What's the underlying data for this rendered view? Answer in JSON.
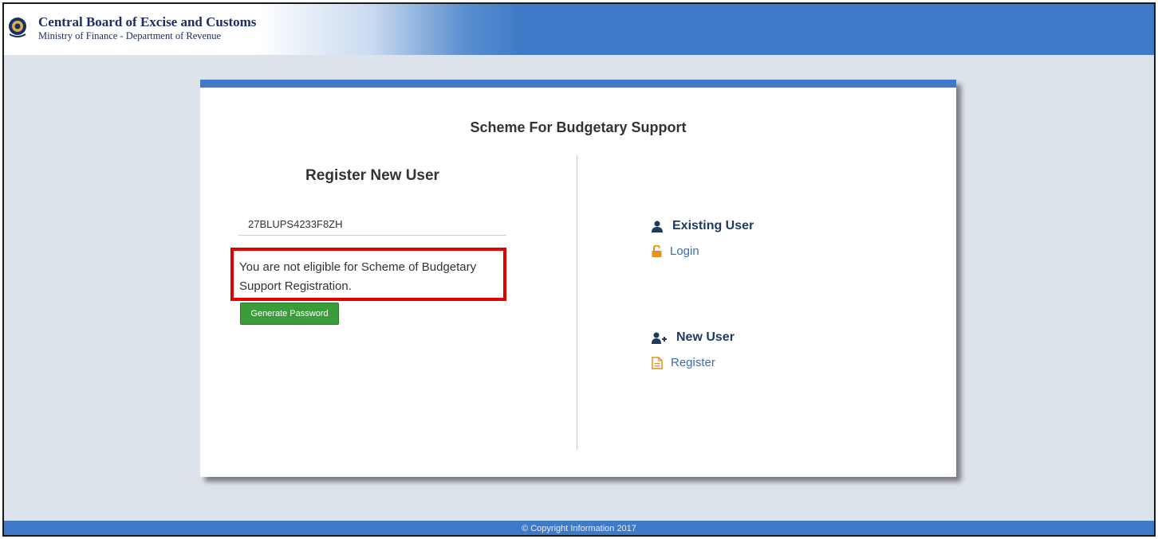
{
  "header": {
    "org_title": "Central Board of Excise and Customs",
    "org_subtitle": "Ministry of Finance - Department of Revenue"
  },
  "card": {
    "title": "Scheme For Budgetary Support"
  },
  "register": {
    "title": "Register New User",
    "gstin_value": "27BLUPS4233F8ZH",
    "message": "You are not eligible for Scheme of Budgetary Support Registration.",
    "button_label": "Generate Password"
  },
  "existing_user": {
    "heading": "Existing User",
    "link_label": "Login"
  },
  "new_user": {
    "heading": "New User",
    "link_label": "Register"
  },
  "footer": {
    "text": "© Copyright Information 2017"
  },
  "colors": {
    "accent": "#3f7ac8",
    "button_green": "#3a9d3a",
    "highlight_red": "#e00000",
    "icon_orange": "#e8901e",
    "heading_navy": "#1e3a5f"
  },
  "icons": [
    "emblem-icon",
    "user-icon",
    "unlock-icon",
    "user-plus-icon",
    "document-icon"
  ]
}
